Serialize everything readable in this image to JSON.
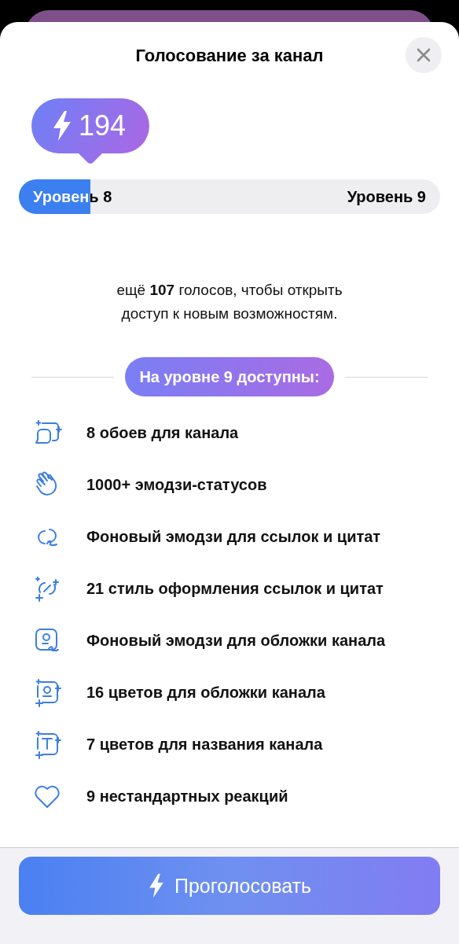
{
  "title": "Голосование за канал",
  "boost_badge": {
    "count": "194"
  },
  "progress": {
    "level": 0.17,
    "current_label": "Уровень 8",
    "next_label": "Уровень 9"
  },
  "message": "ещё **107** голосов, чтобы открыть доступ к новым возможностям.",
  "section_label": "На уровне 9 доступны:",
  "features": [
    {
      "kind": "wallpaper",
      "label": "8 обоев для канала"
    },
    {
      "kind": "hand",
      "label": "1000+ эмодзи-статусов"
    },
    {
      "kind": "link-emoji",
      "label": "Фоновый эмодзи для ссылок и цитат"
    },
    {
      "kind": "link-style",
      "label": "21 стиль оформления ссылок и цитат"
    },
    {
      "kind": "cover-emoji",
      "label": "Фоновый эмодзи для обложки канала"
    },
    {
      "kind": "cover-color",
      "label": "16 цветов для обложки канала"
    },
    {
      "kind": "name-color",
      "label": "7 цветов для названия канала"
    },
    {
      "kind": "heart",
      "label": "9 нестандартных реакций"
    }
  ],
  "vote_button": {
    "label": "Проголосовать"
  }
}
